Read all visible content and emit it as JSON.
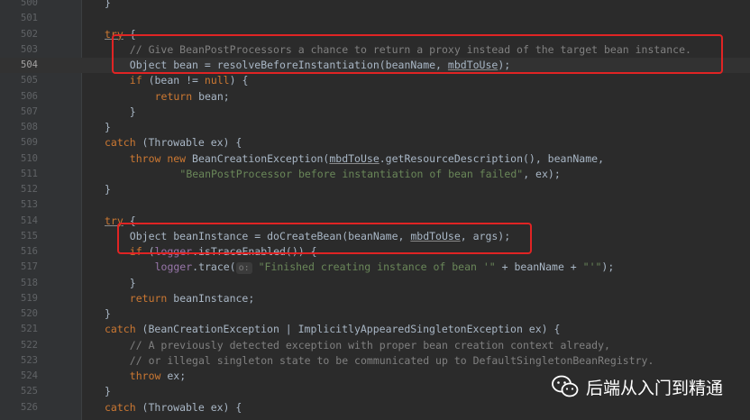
{
  "editor": {
    "lines": [
      {
        "num": "500",
        "indent": 8,
        "tokens": [
          {
            "t": "}",
            "c": ""
          }
        ]
      },
      {
        "num": "501",
        "indent": 0,
        "tokens": []
      },
      {
        "num": "502",
        "indent": 8,
        "tokens": [
          {
            "t": "try",
            "c": "kw underline"
          },
          {
            "t": " {",
            "c": ""
          }
        ]
      },
      {
        "num": "503",
        "indent": 12,
        "tokens": [
          {
            "t": "// Give BeanPostProcessors a chance to return a proxy instead of the target bean instance.",
            "c": "cm"
          }
        ]
      },
      {
        "num": "504",
        "indent": 12,
        "current": true,
        "tokens": [
          {
            "t": "Object bean = ",
            "c": ""
          },
          {
            "t": "resolveBeforeInstantiation",
            "c": "call"
          },
          {
            "t": "(beanName, ",
            "c": ""
          },
          {
            "t": "mbdToUse",
            "c": "underline"
          },
          {
            "t": ");",
            "c": ""
          }
        ]
      },
      {
        "num": "505",
        "indent": 12,
        "tokens": [
          {
            "t": "if",
            "c": "kw"
          },
          {
            "t": " (bean != ",
            "c": ""
          },
          {
            "t": "null",
            "c": "kw"
          },
          {
            "t": ") {",
            "c": ""
          }
        ]
      },
      {
        "num": "506",
        "indent": 16,
        "tokens": [
          {
            "t": "return",
            "c": "kw"
          },
          {
            "t": " bean;",
            "c": ""
          }
        ]
      },
      {
        "num": "507",
        "indent": 12,
        "tokens": [
          {
            "t": "}",
            "c": ""
          }
        ]
      },
      {
        "num": "508",
        "indent": 8,
        "tokens": [
          {
            "t": "}",
            "c": ""
          }
        ]
      },
      {
        "num": "509",
        "indent": 8,
        "tokens": [
          {
            "t": "catch",
            "c": "kw"
          },
          {
            "t": " (Throwable ex) {",
            "c": ""
          }
        ]
      },
      {
        "num": "510",
        "indent": 12,
        "tokens": [
          {
            "t": "throw new",
            "c": "kw"
          },
          {
            "t": " BeanCreationException(",
            "c": ""
          },
          {
            "t": "mbdToUse",
            "c": "underline"
          },
          {
            "t": ".getResourceDescription(), beanName,",
            "c": ""
          }
        ]
      },
      {
        "num": "511",
        "indent": 20,
        "tokens": [
          {
            "t": "\"BeanPostProcessor before instantiation of bean failed\"",
            "c": "str"
          },
          {
            "t": ", ex);",
            "c": ""
          }
        ]
      },
      {
        "num": "512",
        "indent": 8,
        "tokens": [
          {
            "t": "}",
            "c": ""
          }
        ]
      },
      {
        "num": "513",
        "indent": 0,
        "tokens": []
      },
      {
        "num": "514",
        "indent": 8,
        "tokens": [
          {
            "t": "try",
            "c": "kw underline"
          },
          {
            "t": " {",
            "c": ""
          }
        ]
      },
      {
        "num": "515",
        "indent": 12,
        "tokens": [
          {
            "t": "Object beanInstance = doCreateBean(beanName, ",
            "c": ""
          },
          {
            "t": "mbdToUse",
            "c": "underline"
          },
          {
            "t": ", args);",
            "c": ""
          }
        ]
      },
      {
        "num": "516",
        "indent": 12,
        "tokens": [
          {
            "t": "if",
            "c": "kw"
          },
          {
            "t": " (",
            "c": ""
          },
          {
            "t": "logger",
            "c": "fld"
          },
          {
            "t": ".isTraceEnabled()) {",
            "c": ""
          }
        ]
      },
      {
        "num": "517",
        "indent": 16,
        "tokens": [
          {
            "t": "logger",
            "c": "fld"
          },
          {
            "t": ".trace(",
            "c": ""
          },
          {
            "t": "o:",
            "c": "param-hint"
          },
          {
            "t": " ",
            "c": ""
          },
          {
            "t": "\"Finished creating instance of bean '\"",
            "c": "str"
          },
          {
            "t": " + beanName + ",
            "c": ""
          },
          {
            "t": "\"'\"",
            "c": "str"
          },
          {
            "t": ");",
            "c": ""
          }
        ]
      },
      {
        "num": "518",
        "indent": 12,
        "tokens": [
          {
            "t": "}",
            "c": ""
          }
        ]
      },
      {
        "num": "519",
        "indent": 12,
        "tokens": [
          {
            "t": "return",
            "c": "kw"
          },
          {
            "t": " beanInstance;",
            "c": ""
          }
        ]
      },
      {
        "num": "520",
        "indent": 8,
        "tokens": [
          {
            "t": "}",
            "c": ""
          }
        ]
      },
      {
        "num": "521",
        "indent": 8,
        "tokens": [
          {
            "t": "catch",
            "c": "kw"
          },
          {
            "t": " (BeanCreationException | ImplicitlyAppearedSingletonException ex) {",
            "c": ""
          }
        ]
      },
      {
        "num": "522",
        "indent": 12,
        "tokens": [
          {
            "t": "// A previously detected exception with proper bean creation context already,",
            "c": "cm"
          }
        ]
      },
      {
        "num": "523",
        "indent": 12,
        "tokens": [
          {
            "t": "// or illegal singleton state to be communicated up to DefaultSingletonBeanRegistry.",
            "c": "cm"
          }
        ]
      },
      {
        "num": "524",
        "indent": 12,
        "tokens": [
          {
            "t": "throw",
            "c": "kw"
          },
          {
            "t": " ex;",
            "c": ""
          }
        ]
      },
      {
        "num": "525",
        "indent": 8,
        "tokens": [
          {
            "t": "}",
            "c": ""
          }
        ]
      },
      {
        "num": "526",
        "indent": 8,
        "tokens": [
          {
            "t": "catch",
            "c": "kw"
          },
          {
            "t": " (Throwable ex) {",
            "c": ""
          }
        ]
      }
    ]
  },
  "watermark": {
    "text": "后端从入门到精通",
    "icon": "wechat-icon"
  },
  "colors": {
    "background": "#2b2b2b",
    "keyword": "#cc7832",
    "comment": "#808080",
    "string": "#6a8759",
    "highlight_box": "#e02424"
  }
}
